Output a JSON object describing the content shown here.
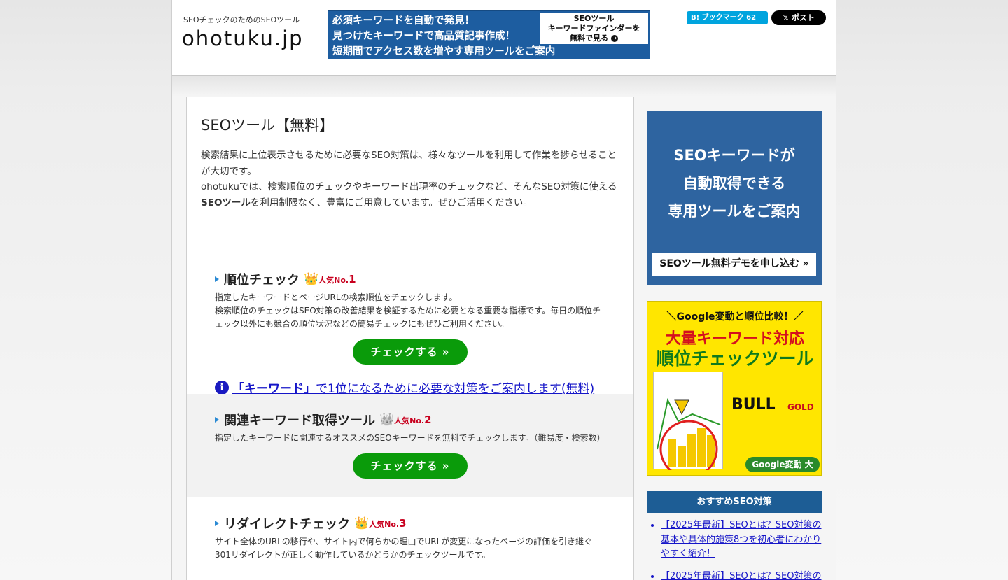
{
  "header": {
    "tagline": "SEOチェックのためのSEOツール",
    "logo": "ohotuku.jp",
    "banner": {
      "lines": [
        "必須キーワードを自動で発見！",
        "見つけたキーワードで高品質記事作成！",
        "短期間でアクセス数を増やす専用ツールをご案内"
      ],
      "cta_lines": [
        "SEOツール",
        "キーワードファインダーを",
        "無料で見る"
      ]
    },
    "hatena_label": "B! ブックマーク",
    "hatena_count": "62",
    "x_post_label": "𝕏 ポスト"
  },
  "main": {
    "title": "SEOツール【無料】",
    "intro_p1": "検索結果に上位表示させるために必要なSEO対策は、様々なツールを利用して作業を捗らせることが大切です。",
    "intro_p2_a": "ohotukuでは、検索順位のチェックやキーワード出現率のチェックなど、そんなSEO対策に使える",
    "intro_p2_b": "SEOツール",
    "intro_p2_c": "を利用制限なく、豊富にご用意しています。ぜひご活用ください。",
    "tools": [
      {
        "title": "順位チェック",
        "rank_label": "人気No.",
        "rank_num": "1",
        "desc": "指定したキーワードとページURLの検索順位をチェックします。\n検索順位のチェックはSEO対策の改善結果を検証するために必要となる重要な指標です。毎日の順位チェック以外にも競合の順位状況などの簡易チェックにもぜひご利用ください。",
        "button": "チェックする »"
      },
      {
        "title": "関連キーワード取得ツール",
        "rank_label": "人気No.",
        "rank_num": "2",
        "desc": "指定したキーワードに関連するオススメのSEOキーワードを無料でチェックします。（難易度・検索数）",
        "button": "チェックする »"
      },
      {
        "title": "リダイレクトチェック",
        "rank_label": "人気No.",
        "rank_num": "3",
        "desc": "サイト全体のURLの移行や、サイト内で何らかの理由でURLが変更になったページの評価を引き継ぐ301リダイレクトが正しく動作しているかどうかのチェックツールです。"
      }
    ],
    "info_link_quote": "「キーワード」",
    "info_link_rest": "で1位になるために必要な対策をご案内します(無料)"
  },
  "sidebar": {
    "ad1_lines": [
      "SEOキーワードが",
      "自動取得できる",
      "専用ツールをご案内"
    ],
    "ad1_button": "SEOツール無料デモを申し込む »",
    "ad2_line1": "＼Google変動と順位比較！／",
    "ad2_line2": "大量キーワード対応",
    "ad2_line3": "順位チェックツール",
    "ad2_bull": "BULL",
    "ad2_gold": "GOLD",
    "ad2_badge": "Google変動 大",
    "recommend_title": "おすすめSEO対策",
    "recommend_items": [
      "【2025年最新】SEOとは？SEO対策の基本や具体的施策8つを初心者にわかりやすく紹介！",
      "【2025年最新】SEOとは？SEO対策の"
    ]
  },
  "colors": {
    "banner_blue": "#1d5da0",
    "button_green": "#0a9b0a",
    "link_blue": "#1515c8",
    "rank_red": "#c8001e",
    "ad_yellow": "#ffe600"
  }
}
